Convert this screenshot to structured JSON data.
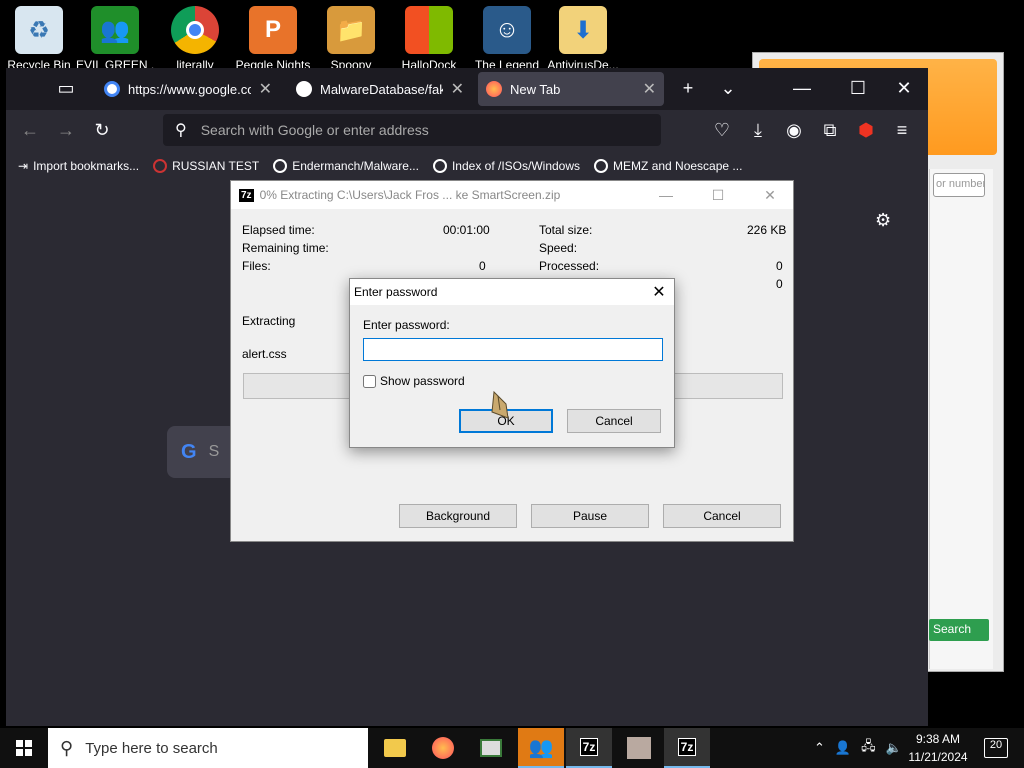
{
  "desktop": {
    "icons": [
      {
        "label": "Recycle Bin",
        "icon": "recycle-bin-icon"
      },
      {
        "label": "EVIL GREEN ...",
        "icon": "green-people-icon"
      },
      {
        "label": "literally",
        "icon": "chrome-icon"
      },
      {
        "label": "Peggle Nights",
        "icon": "peggle-icon"
      },
      {
        "label": "Spoopy",
        "icon": "folder-icon"
      },
      {
        "label": "HalloDock",
        "icon": "windows-logo-icon"
      },
      {
        "label": "The Legend",
        "icon": "game-character-icon"
      },
      {
        "label": "AntivirusDe...",
        "icon": "download-folder-icon"
      }
    ]
  },
  "background_window": {
    "number_placeholder": "or number",
    "search_label": "Search"
  },
  "browser": {
    "tabs": [
      {
        "title": "https://www.google.com",
        "icon": "google-icon"
      },
      {
        "title": "MalwareDatabase/fakesc",
        "icon": "github-icon"
      },
      {
        "title": "New Tab",
        "icon": "firefox-icon"
      }
    ],
    "address_placeholder": "Search with Google or enter address",
    "bookmarks": [
      {
        "label": "Import bookmarks...",
        "icon": "import-icon"
      },
      {
        "label": "RUSSIAN TEST",
        "icon": "red-circle-icon"
      },
      {
        "label": "Endermanch/Malware...",
        "icon": "google-icon"
      },
      {
        "label": "Index of /ISOs/Windows",
        "icon": "google-icon"
      },
      {
        "label": "MEMZ and Noescape ...",
        "icon": "globe-icon"
      }
    ],
    "google_search_fragment": "S"
  },
  "zip_progress": {
    "title": "0% Extracting C:\\Users\\Jack Fros ... ke SmartScreen.zip",
    "elapsed_label": "Elapsed time:",
    "elapsed_value": "00:01:00",
    "remaining_label": "Remaining time:",
    "files_label": "Files:",
    "files_value": "0",
    "total_size_label": "Total size:",
    "total_size_value": "226 KB",
    "speed_label": "Speed:",
    "processed_label": "Processed:",
    "processed_value": "0",
    "fourth_value": "0",
    "extracting_label": "Extracting",
    "current_file": "alert.css",
    "background_button": "Background",
    "pause_button": "Pause",
    "cancel_button": "Cancel",
    "progress": 0
  },
  "password_dialog": {
    "title": "Enter password",
    "prompt": "Enter password:",
    "show_password_label": "Show password",
    "ok_button": "OK",
    "cancel_button": "Cancel"
  },
  "taskbar": {
    "search_placeholder": "Type here to search",
    "items": [
      "file-explorer-icon",
      "firefox-icon",
      "app-window-icon",
      "green-people-icon",
      "7zip-icon",
      "cat-photo-icon",
      "7zip-icon"
    ],
    "time": "9:38 AM",
    "date": "11/21/2024",
    "notification_count": "20"
  },
  "colors": {
    "accent": "#0078d7",
    "firefox_bg": "#1c1b22",
    "firefox_toolbar": "#2b2a33"
  }
}
